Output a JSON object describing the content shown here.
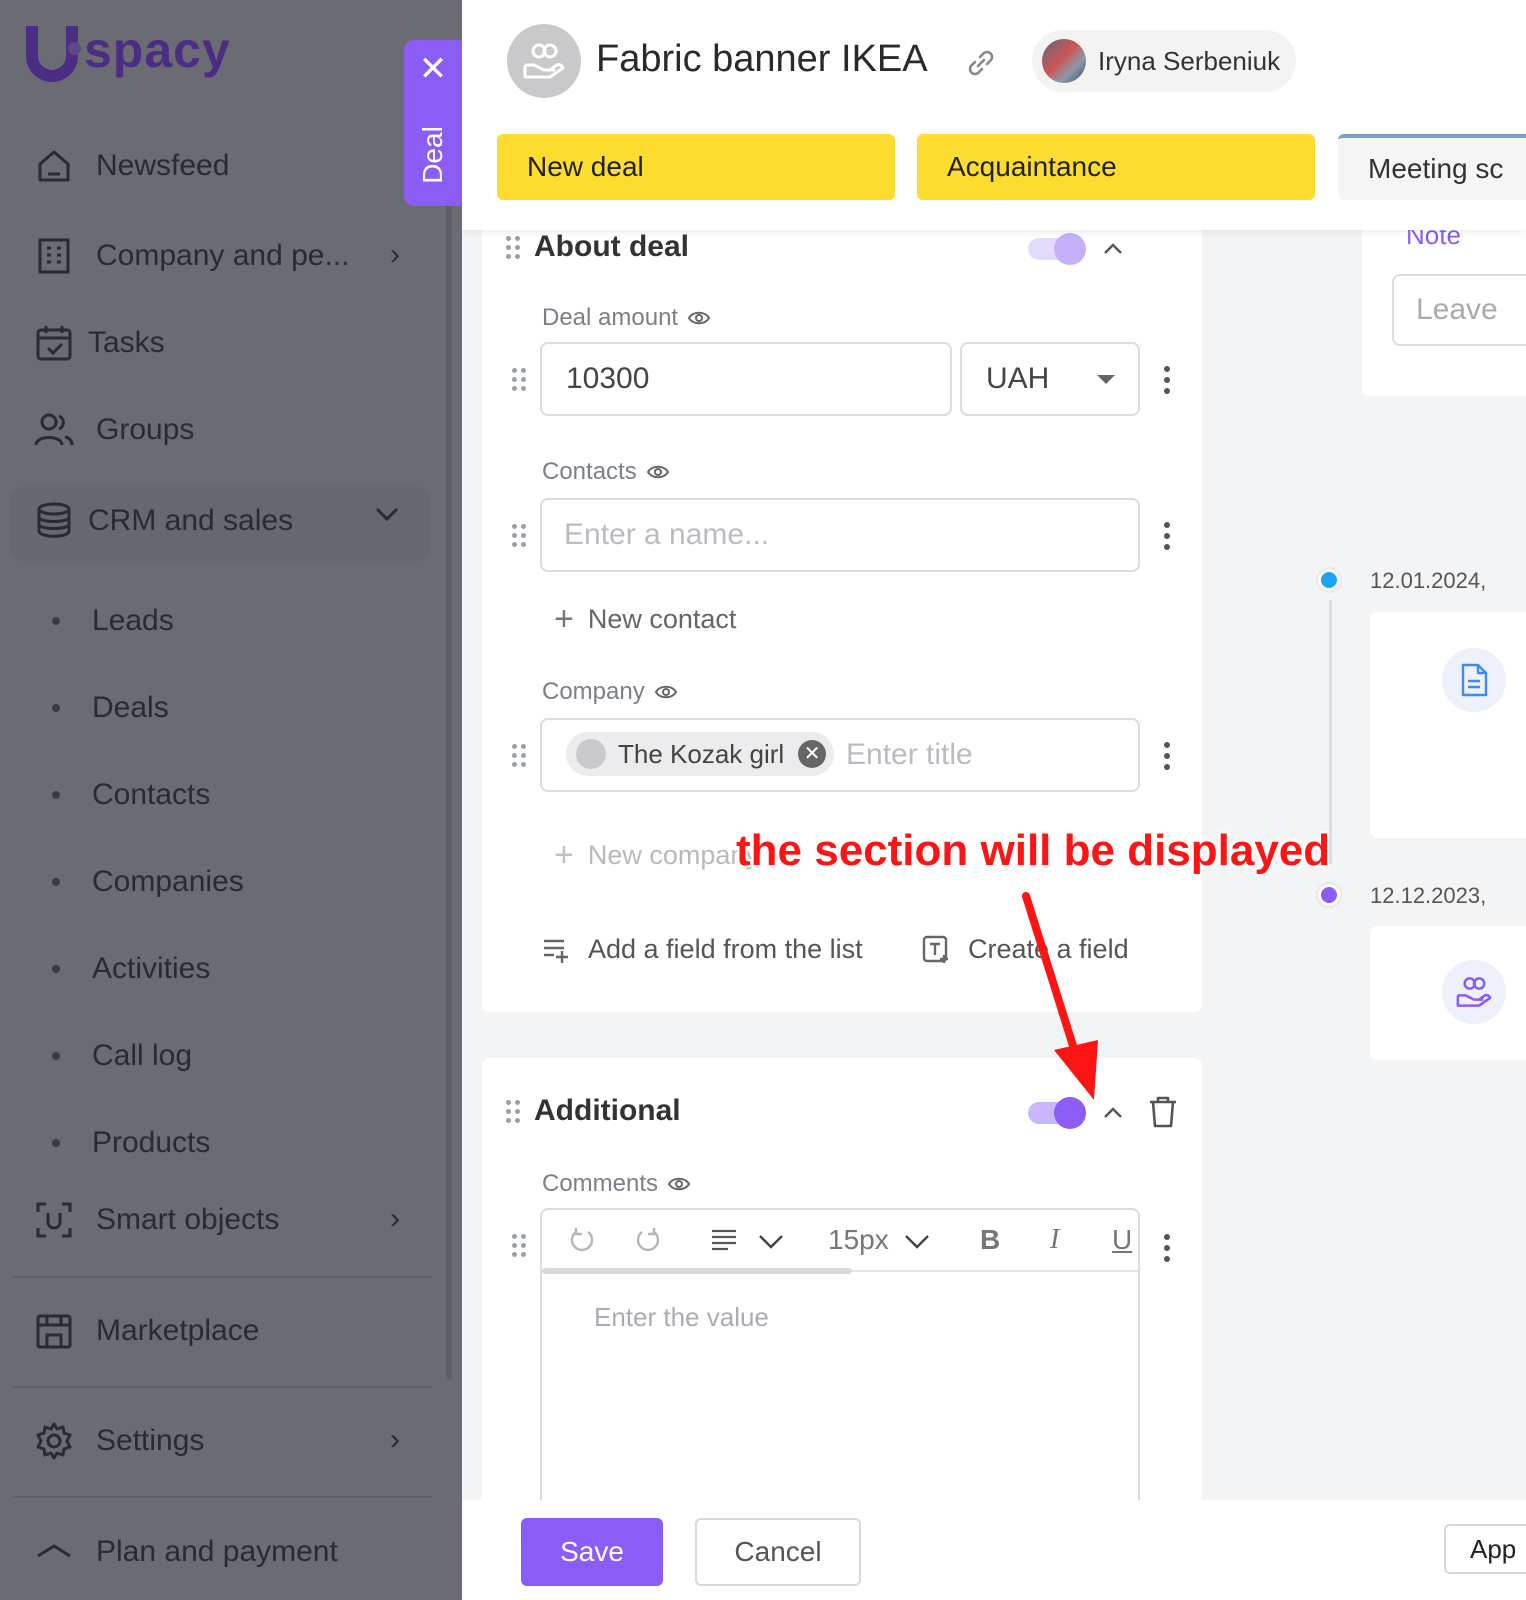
{
  "sidebar": {
    "logo_text": "spacy",
    "items": [
      {
        "label": "Newsfeed",
        "icon": "home-icon"
      },
      {
        "label": "Company and pe...",
        "icon": "building-icon"
      },
      {
        "label": "Tasks",
        "icon": "calendar-check-icon"
      },
      {
        "label": "Groups",
        "icon": "users-icon"
      },
      {
        "label": "CRM and sales",
        "icon": "database-icon"
      },
      {
        "label": "Smart objects",
        "icon": "smart-objects-icon"
      },
      {
        "label": "Marketplace",
        "icon": "store-icon"
      },
      {
        "label": "Settings",
        "icon": "gear-icon"
      },
      {
        "label": "Plan and payment",
        "icon": "plan-icon"
      }
    ],
    "crm_subitems": [
      "Leads",
      "Deals",
      "Contacts",
      "Companies",
      "Activities",
      "Call log",
      "Products"
    ]
  },
  "deal_tab": {
    "label": "Deal"
  },
  "header": {
    "title": "Fabric banner IKEA",
    "responsible": "Iryna Serbeniuk",
    "stages": [
      "New deal",
      "Acquaintance",
      "Meeting sc"
    ]
  },
  "about_deal": {
    "title": "About deal",
    "deal_amount_label": "Deal amount",
    "deal_amount_value": "10300",
    "currency": "UAH",
    "contacts_label": "Contacts",
    "contacts_placeholder": "Enter a name...",
    "new_contact": "New contact",
    "company_label": "Company",
    "company_chip": "The Kozak girl",
    "company_placeholder": "Enter title",
    "new_company": "New company",
    "add_field": "Add a field from the list",
    "create_field": "Create a field"
  },
  "additional": {
    "title": "Additional",
    "comments_label": "Comments",
    "font_size": "15px",
    "bold": "B",
    "italic": "I",
    "underline": "U",
    "editor_placeholder": "Enter the value"
  },
  "right_panel": {
    "note_tab": "Note",
    "note_placeholder": "Leave",
    "timeline": [
      {
        "date": "12.01.2024,",
        "color": "#1aa3f5"
      },
      {
        "date": "12.12.2023,",
        "color": "#8b5cf6"
      }
    ]
  },
  "footer": {
    "save": "Save",
    "cancel": "Cancel",
    "app": "App"
  },
  "annotation": {
    "text": "the section will be displayed",
    "color": "#ff1414"
  },
  "colors": {
    "accent": "#8b5cf6",
    "stage_active": "#fcdc2e",
    "sidebar_overlay": "#6b6b74"
  }
}
